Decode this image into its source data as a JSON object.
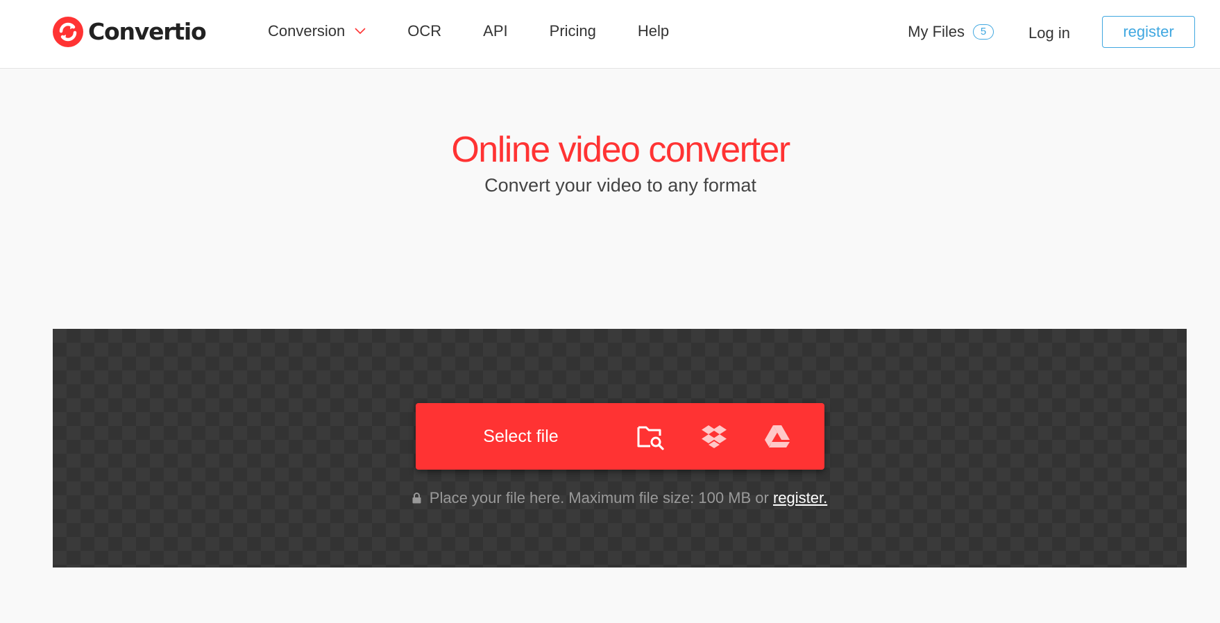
{
  "header": {
    "logo_text": "Convertio",
    "nav": [
      {
        "label": "Conversion",
        "has_dropdown": true
      },
      {
        "label": "OCR"
      },
      {
        "label": "API"
      },
      {
        "label": "Pricing"
      },
      {
        "label": "Help"
      }
    ],
    "my_files_label": "My Files",
    "my_files_count": "5",
    "login_label": "Log in",
    "register_label": "register"
  },
  "hero": {
    "title": "Online video converter",
    "subtitle": "Convert your video to any format"
  },
  "upload": {
    "select_label": "Select file",
    "sources": [
      "folder-search-icon",
      "dropbox-icon",
      "google-drive-icon"
    ],
    "hint_text": "Place your file here. Maximum file size: 100 MB or",
    "hint_link": "register."
  },
  "colors": {
    "brand_red": "#ff3333",
    "accent_blue": "#3fa7e0",
    "dropzone_bg": "#3a3a3a",
    "page_bg": "#f9f9f9"
  }
}
